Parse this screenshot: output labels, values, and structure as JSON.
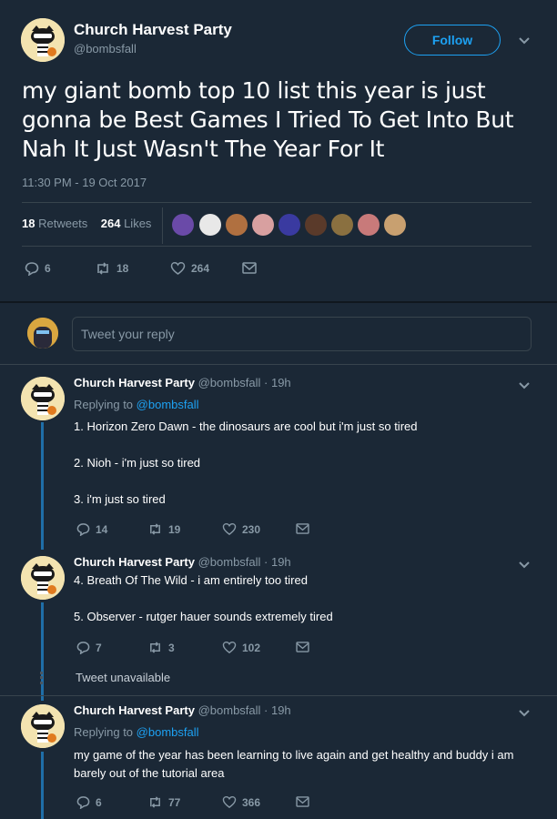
{
  "tweet": {
    "author_name": "Church Harvest Party",
    "handle": "@bombsfall",
    "follow_label": "Follow",
    "text": "my giant bomb top 10 list this year is just gonna be Best Games I Tried To Get Into But Nah It Just Wasn't The Year For It",
    "timestamp": "11:30 PM - 19 Oct 2017",
    "retweets_count": "18",
    "retweets_label": "Retweets",
    "likes_count": "264",
    "likes_label": "Likes",
    "actions": {
      "replies": "6",
      "retweets": "18",
      "likes": "264"
    }
  },
  "reply_box": {
    "placeholder": "Tweet your reply"
  },
  "replies": [
    {
      "author_name": "Church Harvest Party",
      "handle_time": "@bombsfall · 19h",
      "replying_prefix": "Replying to",
      "replying_to": "@bombsfall",
      "lines": [
        "1. Horizon Zero Dawn - the dinosaurs are cool but i'm just so tired",
        "2. Nioh - i'm just so tired",
        "3. i'm just so tired"
      ],
      "actions": {
        "replies": "14",
        "retweets": "19",
        "likes": "230"
      }
    },
    {
      "author_name": "Church Harvest Party",
      "handle_time": "@bombsfall · 19h",
      "lines": [
        "4. Breath Of The Wild - i am entirely too tired",
        "5. Observer - rutger hauer sounds extremely tired"
      ],
      "actions": {
        "replies": "7",
        "retweets": "3",
        "likes": "102"
      }
    },
    {
      "unavailable": "Tweet unavailable"
    },
    {
      "author_name": "Church Harvest Party",
      "handle_time": "@bombsfall · 19h",
      "replying_prefix": "Replying to",
      "replying_to": "@bombsfall",
      "lines": [
        "my game of the year has been learning to live again and get healthy and buddy i am barely out of the tutorial area"
      ],
      "actions": {
        "replies": "6",
        "retweets": "77",
        "likes": "366"
      }
    }
  ],
  "colors": {
    "background": "#1b2836",
    "accent": "#1da1f2",
    "muted": "#8899a6",
    "divider": "#38444d",
    "thread": "#1f6ea8"
  }
}
